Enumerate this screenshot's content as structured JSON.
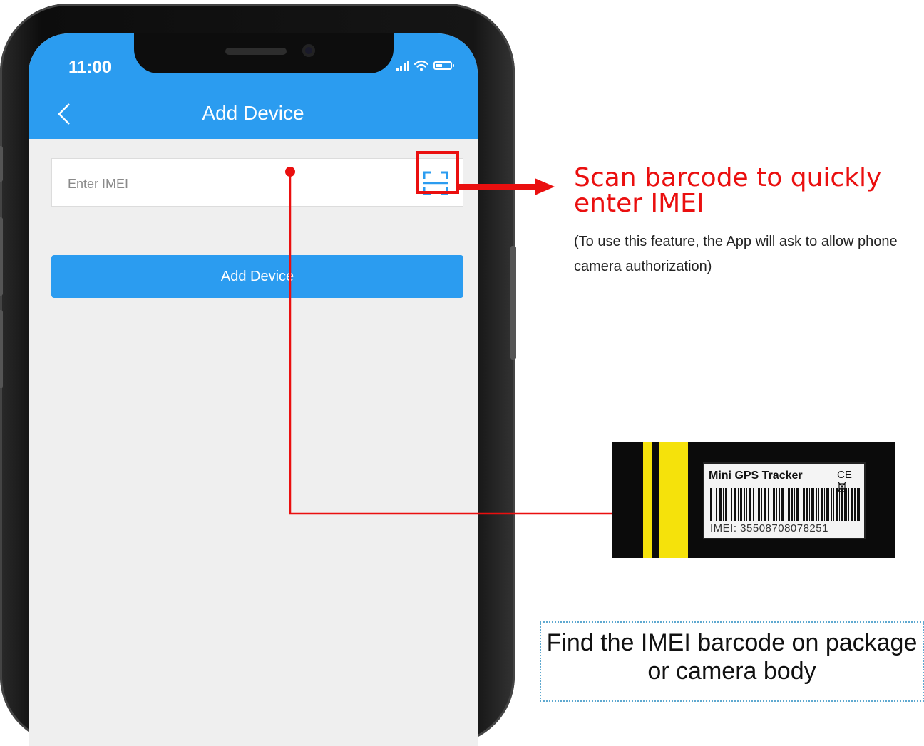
{
  "status_bar": {
    "time": "11:00",
    "icons": [
      "signal-icon",
      "wifi-icon",
      "battery-icon"
    ]
  },
  "header": {
    "back_icon": "chevron-left-icon",
    "title": "Add Device"
  },
  "form": {
    "imei_placeholder": "Enter IMEI",
    "imei_value": "",
    "scan_icon": "scan-barcode-icon",
    "submit_label": "Add Device"
  },
  "annotations": {
    "scan_title": "Scan barcode to quickly enter IMEI",
    "scan_note": "(To use this feature, the App will ask to allow phone camera authorization)",
    "find_text": "Find the IMEI barcode on package or camera body"
  },
  "device_label": {
    "product_name": "Mini GPS Tracker",
    "marks": "CE",
    "imei_text": "IMEI: 35508708078251"
  },
  "colors": {
    "accent_blue": "#2b9cf0",
    "annotation_red": "#ea0f0f",
    "label_yellow": "#f5e20b",
    "screen_bg": "#efefef"
  }
}
